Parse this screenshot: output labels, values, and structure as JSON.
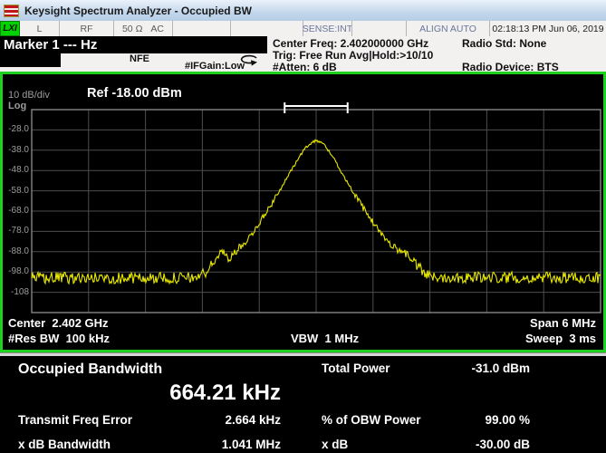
{
  "window": {
    "title": "Keysight Spectrum Analyzer - Occupied BW"
  },
  "status_bar": {
    "lxi": "LXI",
    "l": "L",
    "rf": "RF",
    "impedance": "50 Ω",
    "coupling": "AC",
    "sense": "SENSE:INT",
    "align": "ALIGN AUTO",
    "datetime": "02:18:13 PM Jun 06, 2019"
  },
  "marker_bar": {
    "text": "Marker 1 --- Hz"
  },
  "meas_strip": {
    "nfe": "NFE",
    "ifgain": "#IFGain:Low"
  },
  "settings": {
    "center_freq": "Center Freq: 2.402000000 GHz",
    "radio_std": "Radio Std: None",
    "trig": "Trig: Free Run",
    "avg_hold": "Avg|Hold:>10/10",
    "atten": "#Atten: 6 dB",
    "radio_device": "Radio Device: BTS"
  },
  "display": {
    "scale": "10 dB/div",
    "ref": "Ref -18.00 dBm",
    "log": "Log"
  },
  "footer": {
    "center": "Center  2.402 GHz",
    "res_bw": "#Res BW  100 kHz",
    "vbw": "VBW  1 MHz",
    "span": "Span 6 MHz",
    "sweep": "Sweep  3 ms"
  },
  "results": {
    "obw_label": "Occupied Bandwidth",
    "obw_value": "664.21 kHz",
    "rows_left": [
      {
        "label": "Transmit Freq Error",
        "value": "2.664 kHz"
      },
      {
        "label": "x dB Bandwidth",
        "value": "1.041 MHz"
      }
    ],
    "rows_right": [
      {
        "label": "Total Power",
        "value": "-31.0 dBm"
      },
      {
        "label": "% of OBW Power",
        "value": "99.00 %"
      },
      {
        "label": "x dB",
        "value": "-30.00 dB"
      }
    ]
  },
  "chart_data": {
    "type": "line",
    "title": "Occupied BW spectrum trace",
    "x_axis": {
      "center_freq": "2.402 GHz",
      "span": "6 MHz",
      "offset_mhz_range": [
        -3,
        3
      ]
    },
    "y_axis": {
      "ref_dbm": -18,
      "db_per_div": 10,
      "ylim": [
        -118,
        -18
      ],
      "tick_labels": [
        "-28.0",
        "-38.0",
        "-48.0",
        "-58.0",
        "-68.0",
        "-78.0",
        "-88.0",
        "-98.0",
        "-108"
      ]
    },
    "grid": {
      "h_divs": 10,
      "v_divs": 10
    },
    "noise_floor_dbm": -101,
    "envelope_points_mhz_dbm": [
      [
        -3.0,
        -101
      ],
      [
        -1.32,
        -101
      ],
      [
        -1.18,
        -99
      ],
      [
        -1.0,
        -88
      ],
      [
        -0.93,
        -91
      ],
      [
        -0.85,
        -88.5
      ],
      [
        -0.74,
        -83
      ],
      [
        -0.6,
        -74
      ],
      [
        -0.45,
        -63
      ],
      [
        -0.3,
        -51
      ],
      [
        -0.2,
        -43
      ],
      [
        -0.1,
        -36
      ],
      [
        0.0,
        -33
      ],
      [
        0.07,
        -34.5
      ],
      [
        0.16,
        -40
      ],
      [
        0.27,
        -49
      ],
      [
        0.42,
        -61
      ],
      [
        0.56,
        -71
      ],
      [
        0.7,
        -80
      ],
      [
        0.8,
        -85
      ],
      [
        0.9,
        -87.5
      ],
      [
        0.98,
        -90
      ],
      [
        1.08,
        -96
      ],
      [
        1.2,
        -100.5
      ],
      [
        3.0,
        -101
      ]
    ],
    "obw_bracket_mhz": [
      -0.332,
      0.332
    ],
    "accent_colors": {
      "trace": "#e8e800",
      "grid": "#4d4d4d",
      "grid_border": "#8f8f8f",
      "bracket": "#ffffff",
      "window_border": "#1ed11e"
    }
  }
}
